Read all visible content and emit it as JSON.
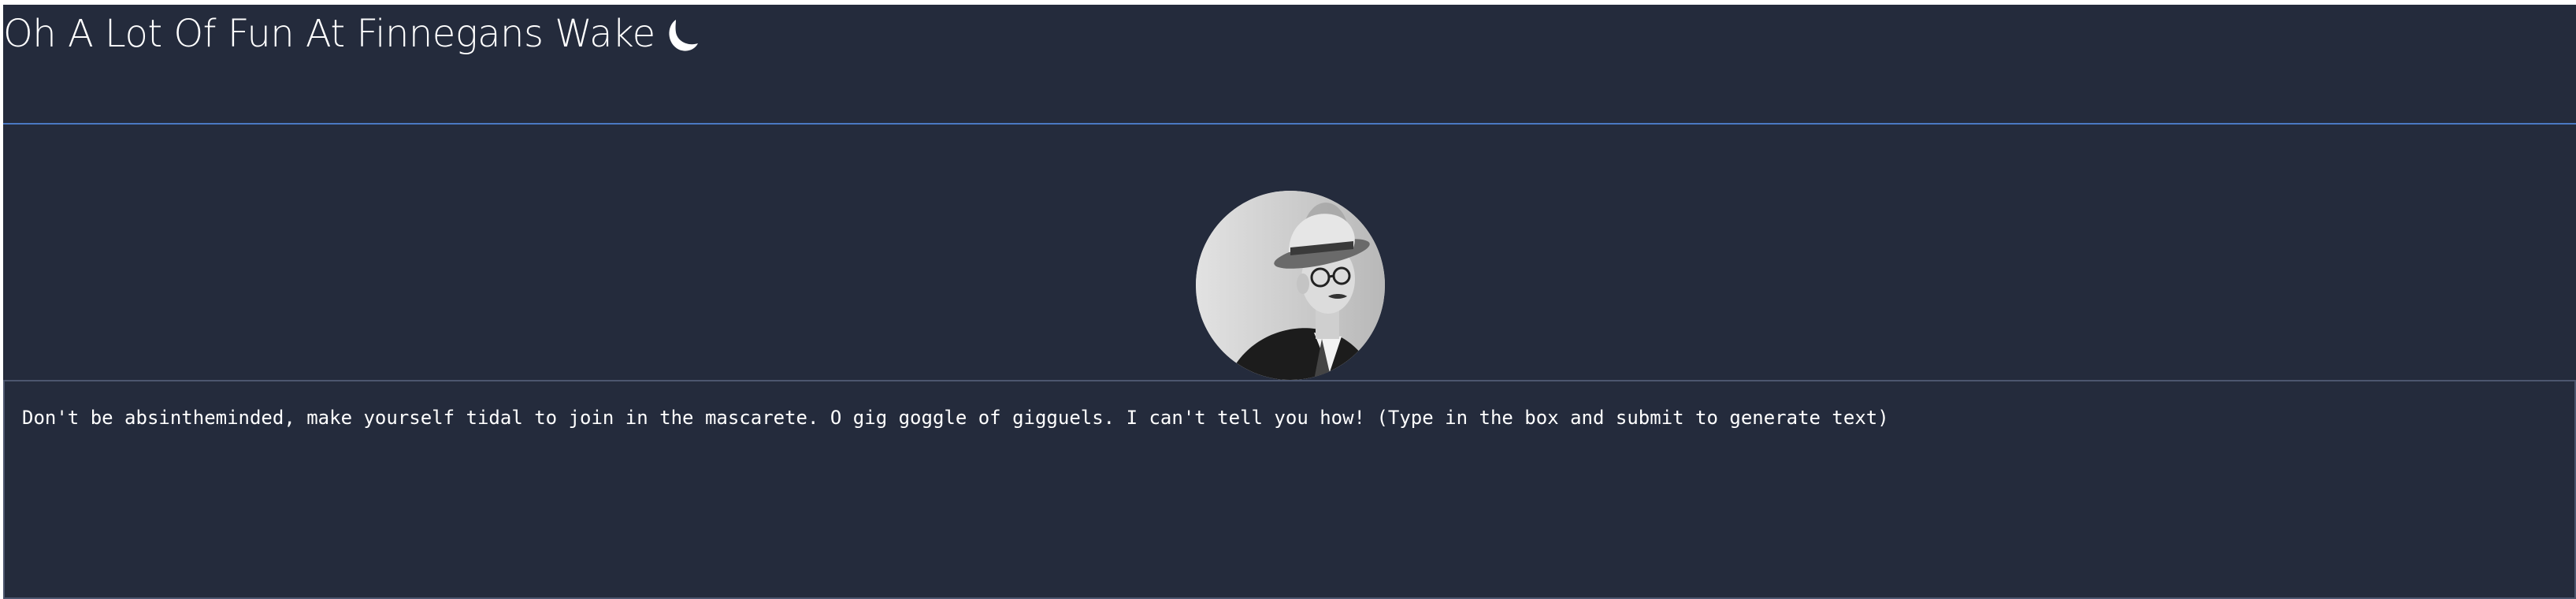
{
  "header": {
    "title": "Oh A Lot Of Fun At Finnegans Wake",
    "icon": "waning-moon-icon",
    "rule_color": "#4a78c2"
  },
  "avatar": {
    "icon": "portrait-photo"
  },
  "prompt": {
    "text": "Don't be absintheminded, make yourself tidal to join in the mascarete. O gig goggle of gigguels. I can't tell you how! (Type in the box and submit to generate text)"
  },
  "colors": {
    "background": "#242b3c",
    "text": "#ffffff",
    "box_border": "#4c566e"
  }
}
